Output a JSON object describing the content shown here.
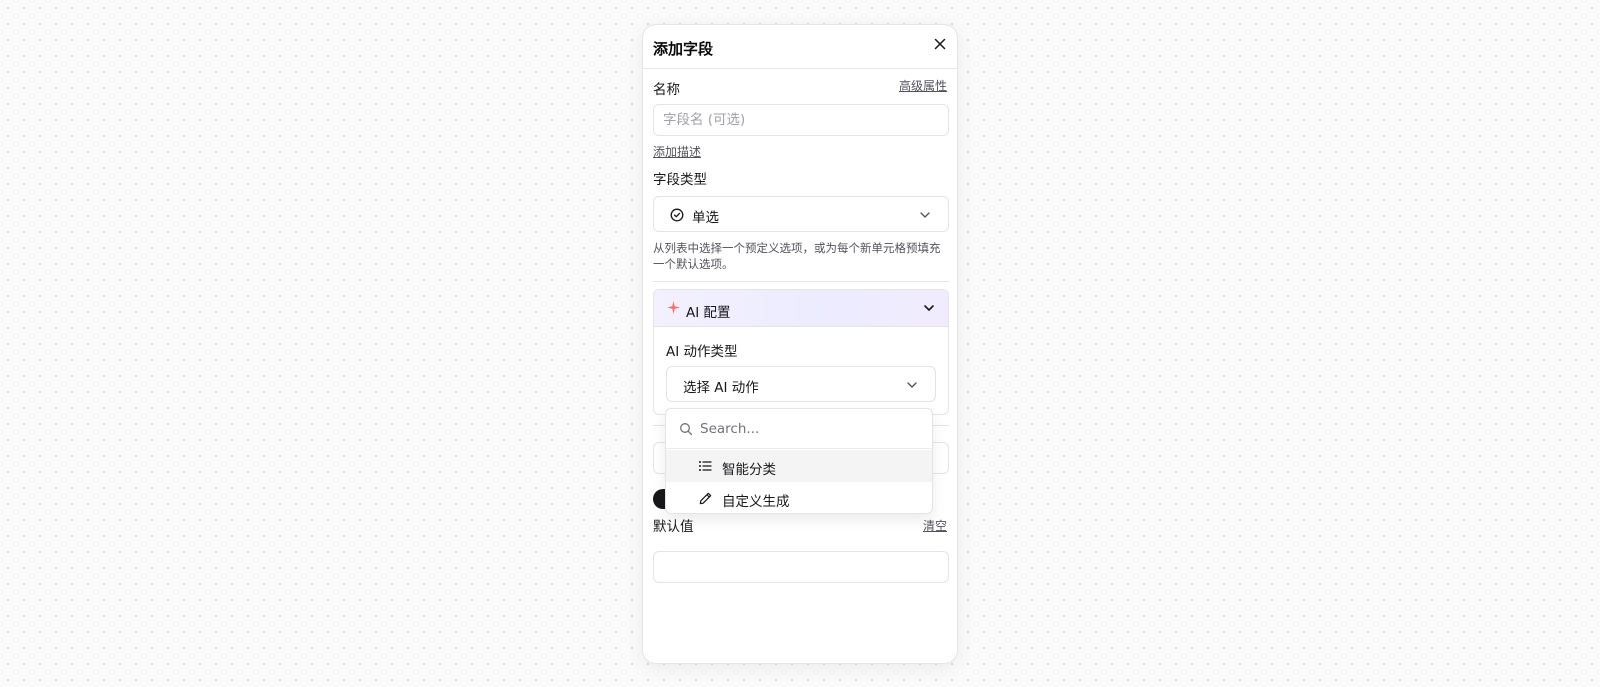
{
  "dialog": {
    "title": "添加字段",
    "name_label": "名称",
    "advanced_link": "高级属性",
    "name_placeholder": "字段名 (可选)",
    "add_desc_link": "添加描述",
    "field_type_label": "字段类型",
    "field_type_value": "单选",
    "field_type_icon": "circle-check-icon",
    "field_type_desc": "从列表中选择一个预定义选项，或为每个新单元格预填充一个默认选项。",
    "ai": {
      "title": "AI 配置",
      "icon": "sparkle-icon",
      "action_label": "AI 动作类型",
      "action_placeholder": "选择 AI 动作"
    },
    "default_label": "默认值",
    "clear_link": "清空"
  },
  "dropdown": {
    "search_placeholder": "Search...",
    "items": [
      {
        "label": "智能分类",
        "icon": "list-icon",
        "highlighted": true
      },
      {
        "label": "自定义生成",
        "icon": "pencil-icon",
        "highlighted": false
      }
    ]
  },
  "colors": {
    "accent_dark": "#18181b",
    "sparkle": "#f87171",
    "ai_gradient": "#ecebff"
  }
}
